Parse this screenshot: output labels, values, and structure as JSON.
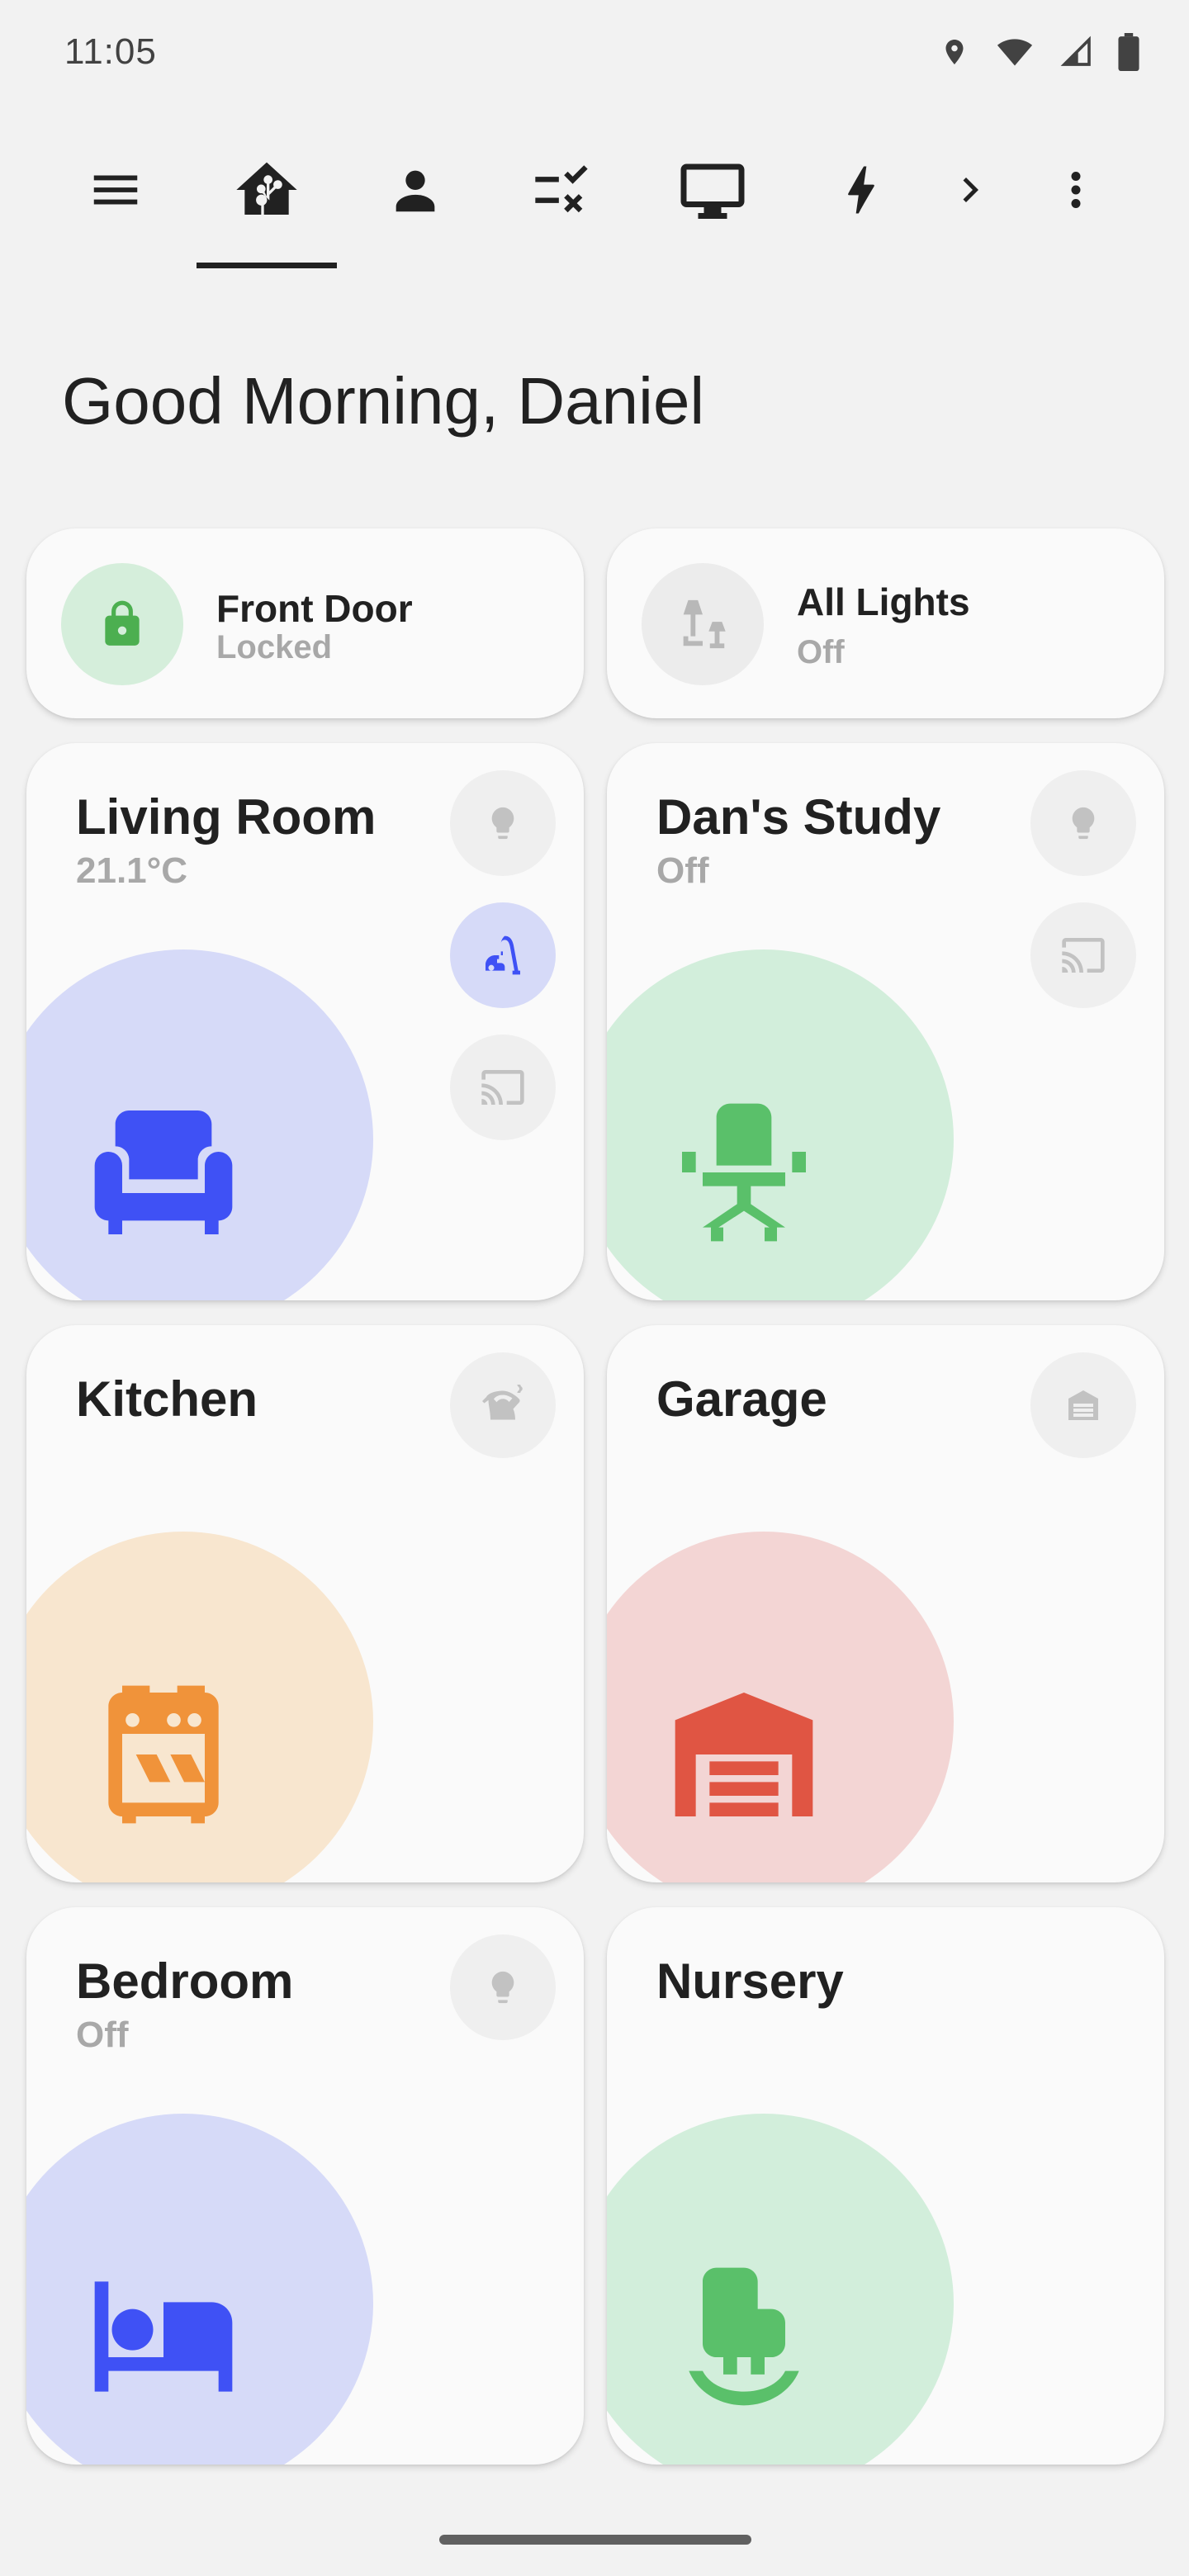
{
  "status_bar": {
    "time": "11:05",
    "icons": [
      "location-icon",
      "wifi-icon",
      "cell-signal-icon",
      "battery-icon"
    ]
  },
  "nav": {
    "tabs": [
      {
        "icon": "menu-icon"
      },
      {
        "icon": "home-assistant-icon",
        "selected": true
      },
      {
        "icon": "person-icon"
      },
      {
        "icon": "checklist-icon"
      },
      {
        "icon": "monitor-icon"
      },
      {
        "icon": "lightning-icon"
      },
      {
        "icon": "chevron-right-icon"
      },
      {
        "icon": "more-vert-icon"
      }
    ]
  },
  "greeting": "Good Morning, Daniel",
  "chips": [
    {
      "title": "Front Door",
      "subtitle": "Locked",
      "icon": "lock-icon",
      "color": "#4caf50"
    },
    {
      "title": "All Lights",
      "subtitle": "Off",
      "icon": "lamps-icon",
      "color": "#b0b0b0"
    }
  ],
  "rooms": [
    {
      "name": "Living Room",
      "subtitle": "21.1°C",
      "icon": "sofa-icon",
      "color": "#3f51f5",
      "bg": "#d6daf8",
      "actions": [
        "lightbulb-icon",
        "vacuum-icon",
        "cast-icon"
      ]
    },
    {
      "name": "Dan's Study",
      "subtitle": "Off",
      "icon": "office-chair-icon",
      "color": "#5ac06a",
      "bg": "#d2eedb",
      "actions": [
        "lightbulb-icon",
        "cast-icon"
      ]
    },
    {
      "name": "Kitchen",
      "subtitle": "",
      "icon": "stove-icon",
      "color": "#f0933a",
      "bg": "#f8e6cf",
      "actions": [
        "kettle-icon"
      ]
    },
    {
      "name": "Garage",
      "subtitle": "",
      "icon": "garage-icon",
      "color": "#e05543",
      "bg": "#f3d5d4",
      "actions": [
        "garage-door-icon"
      ]
    },
    {
      "name": "Bedroom",
      "subtitle": "Off",
      "icon": "bed-icon",
      "color": "#3f51f5",
      "bg": "#d6daf8",
      "actions": [
        "lightbulb-icon"
      ]
    },
    {
      "name": "Nursery",
      "subtitle": "",
      "icon": "cradle-icon",
      "color": "#5ac06a",
      "bg": "#d2eedb",
      "actions": []
    }
  ]
}
